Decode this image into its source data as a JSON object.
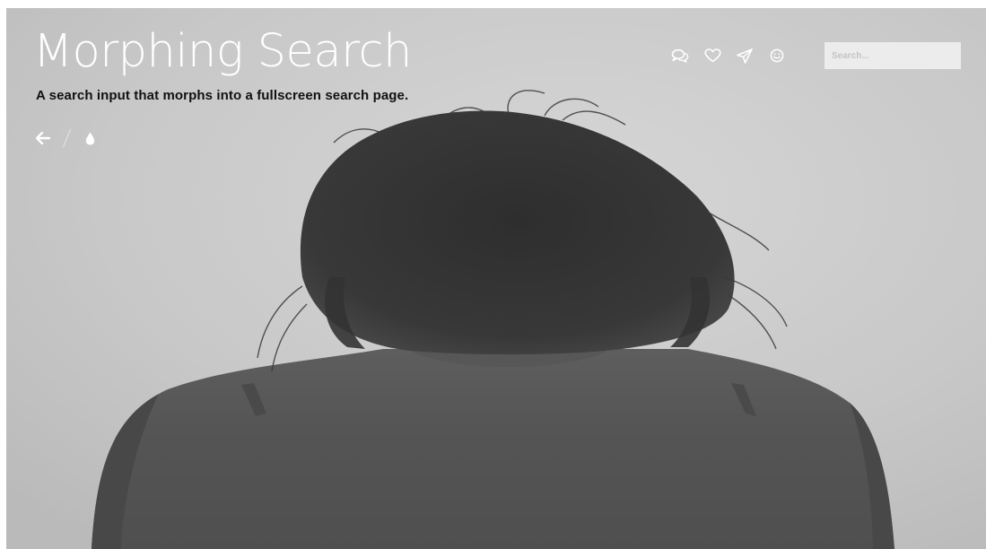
{
  "header": {
    "title": "Morphing Search",
    "subtitle": "A search input that morphs into a fullscreen search page."
  },
  "demo_nav": {
    "back_icon": "arrow-left-icon",
    "demo_icon": "drop-icon"
  },
  "top_icons": [
    {
      "name": "comments-icon"
    },
    {
      "name": "heart-icon"
    },
    {
      "name": "paper-plane-icon"
    },
    {
      "name": "smiley-icon"
    }
  ],
  "search": {
    "placeholder": "Search...",
    "value": ""
  },
  "colors": {
    "title": "#ffffff",
    "subtitle": "#111111",
    "search_bg": "#ececec"
  }
}
